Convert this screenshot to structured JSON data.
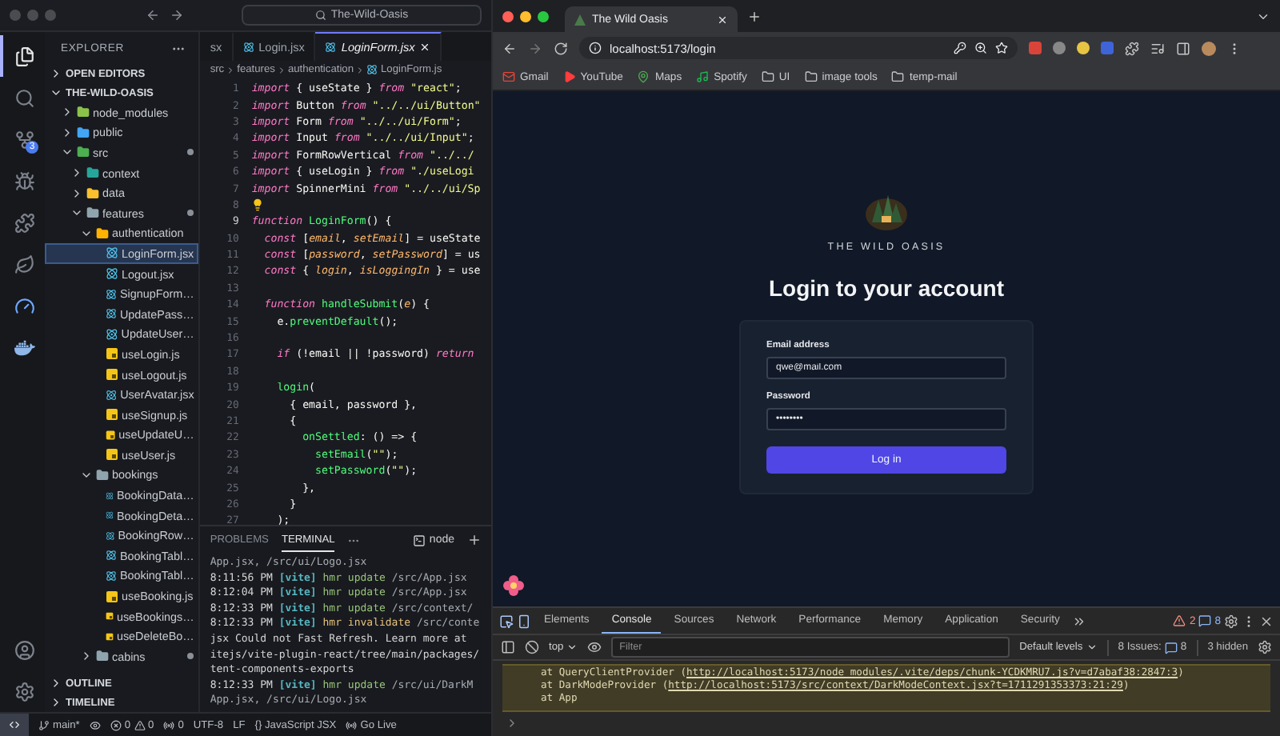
{
  "vscode": {
    "search": "The-Wild-Oasis",
    "activity_bar": [
      {
        "selected": true
      },
      {
        "selected": false
      },
      {
        "selected": false,
        "badge": "3"
      },
      {
        "selected": false
      },
      {
        "selected": false
      },
      {
        "selected": false
      },
      {
        "selected": false
      },
      {
        "selected": false
      }
    ],
    "explorer": {
      "title": "EXPLORER",
      "open_editors": {
        "label": "OPEN EDITORS",
        "expanded": false
      },
      "project": {
        "label": "THE-WILD-OASIS",
        "expanded": true
      },
      "tree": [
        {
          "name": "node_modules",
          "kind": "folder",
          "color": "#8bc34a",
          "expanded": false,
          "modified": false,
          "selected": false
        },
        {
          "name": "public",
          "kind": "folder",
          "color": "#42a5f5",
          "expanded": false,
          "modified": false,
          "selected": false
        },
        {
          "name": "src",
          "kind": "folder",
          "color": "#4caf50",
          "expanded": true,
          "modified": true,
          "selected": false,
          "children": [
            {
              "name": "context",
              "kind": "folder",
              "color": "#26a69a",
              "expanded": false,
              "modified": false,
              "selected": false
            },
            {
              "name": "data",
              "kind": "folder",
              "color": "#fbc02d",
              "expanded": false,
              "modified": false,
              "selected": false
            },
            {
              "name": "features",
              "kind": "folder",
              "color": "#90a4ae",
              "expanded": true,
              "modified": true,
              "selected": false,
              "children": [
                {
                  "name": "authentication",
                  "kind": "folder",
                  "color": "#ffb300",
                  "expanded": true,
                  "modified": false,
                  "selected": false,
                  "children": [
                    {
                      "name": "LoginForm.jsx",
                      "kind": "react",
                      "selected": true
                    },
                    {
                      "name": "Logout.jsx",
                      "kind": "react",
                      "selected": false
                    },
                    {
                      "name": "SignupForm…",
                      "kind": "react",
                      "selected": false
                    },
                    {
                      "name": "UpdatePass…",
                      "kind": "react",
                      "selected": false
                    },
                    {
                      "name": "UpdateUser…",
                      "kind": "react",
                      "selected": false
                    },
                    {
                      "name": "useLogin.js",
                      "kind": "js",
                      "selected": false
                    },
                    {
                      "name": "useLogout.js",
                      "kind": "js",
                      "selected": false
                    },
                    {
                      "name": "UserAvatar.jsx",
                      "kind": "react",
                      "selected": false
                    },
                    {
                      "name": "useSignup.js",
                      "kind": "js",
                      "selected": false
                    },
                    {
                      "name": "useUpdateU…",
                      "kind": "js",
                      "selected": false
                    },
                    {
                      "name": "useUser.js",
                      "kind": "js",
                      "selected": false
                    }
                  ]
                },
                {
                  "name": "bookings",
                  "kind": "folder",
                  "color": "#90a4ae",
                  "expanded": true,
                  "modified": false,
                  "selected": false,
                  "children": [
                    {
                      "name": "BookingData…",
                      "kind": "react",
                      "selected": false
                    },
                    {
                      "name": "BookingDeta…",
                      "kind": "react",
                      "selected": false
                    },
                    {
                      "name": "BookingRow…",
                      "kind": "react",
                      "selected": false
                    },
                    {
                      "name": "BookingTabl…",
                      "kind": "react",
                      "selected": false
                    },
                    {
                      "name": "BookingTabl…",
                      "kind": "react",
                      "selected": false
                    },
                    {
                      "name": "useBooking.js",
                      "kind": "js",
                      "selected": false
                    },
                    {
                      "name": "useBookings…",
                      "kind": "js",
                      "selected": false
                    },
                    {
                      "name": "useDeleteBo…",
                      "kind": "js",
                      "selected": false
                    }
                  ]
                },
                {
                  "name": "cabins",
                  "kind": "folder",
                  "color": "#90a4ae",
                  "expanded": false,
                  "modified": true,
                  "selected": false
                }
              ]
            }
          ]
        }
      ],
      "outline": {
        "label": "OUTLINE",
        "expanded": false
      },
      "timeline": {
        "label": "TIMELINE",
        "expanded": false
      }
    },
    "tabs": [
      {
        "label": "sx",
        "selected": false,
        "icon": false
      },
      {
        "label": "Login.jsx",
        "selected": false,
        "icon": true
      },
      {
        "label": "LoginForm.jsx",
        "selected": true,
        "icon": true
      }
    ],
    "breadcrumb": [
      "src",
      "features",
      "authentication",
      "LoginForm.js"
    ],
    "code": [
      {
        "n": "1",
        "current": false,
        "tokens": [
          {
            "kind": "k",
            "text": "import"
          },
          {
            "kind": "p",
            "text": " { useState } "
          },
          {
            "kind": "k",
            "text": "from"
          },
          {
            "kind": "s",
            "text": " \"react\""
          },
          {
            "kind": "p",
            "text": ";"
          }
        ]
      },
      {
        "n": "2",
        "current": false,
        "tokens": [
          {
            "kind": "k",
            "text": "import"
          },
          {
            "kind": "p",
            "text": " Button "
          },
          {
            "kind": "k",
            "text": "from"
          },
          {
            "kind": "s",
            "text": " \"../../ui/Button\""
          }
        ]
      },
      {
        "n": "3",
        "current": false,
        "tokens": [
          {
            "kind": "k",
            "text": "import"
          },
          {
            "kind": "p",
            "text": " Form "
          },
          {
            "kind": "k",
            "text": "from"
          },
          {
            "kind": "s",
            "text": " \"../../ui/Form\""
          },
          {
            "kind": "p",
            "text": ";"
          }
        ]
      },
      {
        "n": "4",
        "current": false,
        "tokens": [
          {
            "kind": "k",
            "text": "import"
          },
          {
            "kind": "p",
            "text": " Input "
          },
          {
            "kind": "k",
            "text": "from"
          },
          {
            "kind": "s",
            "text": " \"../../ui/Input\""
          },
          {
            "kind": "p",
            "text": ";"
          }
        ]
      },
      {
        "n": "5",
        "current": false,
        "tokens": [
          {
            "kind": "k",
            "text": "import"
          },
          {
            "kind": "p",
            "text": " FormRowVertical "
          },
          {
            "kind": "k",
            "text": "from"
          },
          {
            "kind": "s",
            "text": " \"../../"
          }
        ]
      },
      {
        "n": "6",
        "current": false,
        "tokens": [
          {
            "kind": "k",
            "text": "import"
          },
          {
            "kind": "p",
            "text": " { useLogin } "
          },
          {
            "kind": "k",
            "text": "from"
          },
          {
            "kind": "s",
            "text": " \"./useLogi"
          }
        ]
      },
      {
        "n": "7",
        "current": false,
        "tokens": [
          {
            "kind": "k",
            "text": "import"
          },
          {
            "kind": "p",
            "text": " SpinnerMini "
          },
          {
            "kind": "k",
            "text": "from"
          },
          {
            "kind": "s",
            "text": " \"../../ui/Sp"
          }
        ]
      },
      {
        "n": "8",
        "current": false,
        "hint": true
      },
      {
        "n": "9",
        "current": true,
        "tokens": [
          {
            "kind": "k",
            "text": "function"
          },
          {
            "kind": "f",
            "text": " LoginForm"
          },
          {
            "kind": "p",
            "text": "() {"
          }
        ]
      },
      {
        "n": "10",
        "current": false,
        "tokens": [
          {
            "kind": "k",
            "text": "  const"
          },
          {
            "kind": "p",
            "text": " ["
          },
          {
            "kind": "v",
            "text": "email"
          },
          {
            "kind": "p",
            "text": ", "
          },
          {
            "kind": "v",
            "text": "setEmail"
          },
          {
            "kind": "p",
            "text": "] = useState"
          }
        ]
      },
      {
        "n": "11",
        "current": false,
        "tokens": [
          {
            "kind": "k",
            "text": "  const"
          },
          {
            "kind": "p",
            "text": " ["
          },
          {
            "kind": "v",
            "text": "password"
          },
          {
            "kind": "p",
            "text": ", "
          },
          {
            "kind": "v",
            "text": "setPassword"
          },
          {
            "kind": "p",
            "text": "] = us"
          }
        ]
      },
      {
        "n": "12",
        "current": false,
        "tokens": [
          {
            "kind": "k",
            "text": "  const"
          },
          {
            "kind": "p",
            "text": " { "
          },
          {
            "kind": "v",
            "text": "login"
          },
          {
            "kind": "p",
            "text": ", "
          },
          {
            "kind": "v",
            "text": "isLoggingIn"
          },
          {
            "kind": "p",
            "text": " } = use"
          }
        ]
      },
      {
        "n": "13",
        "current": false
      },
      {
        "n": "14",
        "current": false,
        "tokens": [
          {
            "kind": "k",
            "text": "  function"
          },
          {
            "kind": "f",
            "text": " handleSubmit"
          },
          {
            "kind": "p",
            "text": "("
          },
          {
            "kind": "v",
            "text": "e"
          },
          {
            "kind": "p",
            "text": ") {"
          }
        ]
      },
      {
        "n": "15",
        "current": false,
        "tokens": [
          {
            "kind": "p",
            "text": "    e."
          },
          {
            "kind": "f",
            "text": "preventDefault"
          },
          {
            "kind": "p",
            "text": "();"
          }
        ]
      },
      {
        "n": "16",
        "current": false
      },
      {
        "n": "17",
        "current": false,
        "tokens": [
          {
            "kind": "k",
            "text": "    if"
          },
          {
            "kind": "p",
            "text": " (!email || !password) "
          },
          {
            "kind": "k",
            "text": "return"
          }
        ]
      },
      {
        "n": "18",
        "current": false
      },
      {
        "n": "19",
        "current": false,
        "tokens": [
          {
            "kind": "f",
            "text": "    login"
          },
          {
            "kind": "p",
            "text": "("
          }
        ]
      },
      {
        "n": "20",
        "current": false,
        "tokens": [
          {
            "kind": "p",
            "text": "      { email, password },"
          }
        ]
      },
      {
        "n": "21",
        "current": false,
        "tokens": [
          {
            "kind": "p",
            "text": "      {"
          }
        ]
      },
      {
        "n": "22",
        "current": false,
        "tokens": [
          {
            "kind": "f",
            "text": "        onSettled"
          },
          {
            "kind": "p",
            "text": ": () => {"
          }
        ]
      },
      {
        "n": "23",
        "current": false,
        "tokens": [
          {
            "kind": "f",
            "text": "          setEmail"
          },
          {
            "kind": "p",
            "text": "("
          },
          {
            "kind": "s",
            "text": "\"\""
          },
          {
            "kind": "p",
            "text": ");"
          }
        ]
      },
      {
        "n": "24",
        "current": false,
        "tokens": [
          {
            "kind": "f",
            "text": "          setPassword"
          },
          {
            "kind": "p",
            "text": "("
          },
          {
            "kind": "s",
            "text": "\"\""
          },
          {
            "kind": "p",
            "text": ");"
          }
        ]
      },
      {
        "n": "25",
        "current": false,
        "tokens": [
          {
            "kind": "p",
            "text": "        },"
          }
        ]
      },
      {
        "n": "26",
        "current": false,
        "tokens": [
          {
            "kind": "p",
            "text": "      }"
          }
        ]
      },
      {
        "n": "27",
        "current": false,
        "tokens": [
          {
            "kind": "p",
            "text": "    );"
          }
        ]
      }
    ],
    "panel": {
      "tabs": [
        {
          "label": "PROBLEMS",
          "selected": false
        },
        {
          "label": "TERMINAL",
          "selected": true
        }
      ],
      "shell": "node",
      "terminal": [
        [
          {
            "kind": "d",
            "text": "App.jsx, /src/ui/Logo.jsx"
          }
        ],
        [
          {
            "kind": "t",
            "text": "8:11:56 PM "
          },
          {
            "kind": "v",
            "text": "[vite]"
          },
          {
            "kind": "g",
            "text": " hmr update "
          },
          {
            "kind": "d",
            "text": "/src/App.jsx"
          }
        ],
        [
          {
            "kind": "t",
            "text": "8:12:04 PM "
          },
          {
            "kind": "v",
            "text": "[vite]"
          },
          {
            "kind": "g",
            "text": " hmr update "
          },
          {
            "kind": "d",
            "text": "/src/App.jsx"
          }
        ],
        [
          {
            "kind": "t",
            "text": "8:12:33 PM "
          },
          {
            "kind": "v",
            "text": "[vite]"
          },
          {
            "kind": "g",
            "text": " hmr update "
          },
          {
            "kind": "d",
            "text": "/src/context/"
          }
        ],
        [
          {
            "kind": "t",
            "text": "8:12:33 PM "
          },
          {
            "kind": "v",
            "text": "[vite]"
          },
          {
            "kind": "y",
            "text": " hmr invalidate "
          },
          {
            "kind": "d",
            "text": "/src/conte"
          }
        ],
        [
          {
            "kind": "t",
            "text": "jsx Could not Fast Refresh. Learn more at"
          }
        ],
        [
          {
            "kind": "t",
            "text": "itejs/vite-plugin-react/tree/main/packages/"
          }
        ],
        [
          {
            "kind": "t",
            "text": "tent-components-exports"
          }
        ],
        [
          {
            "kind": "t",
            "text": "8:12:33 PM "
          },
          {
            "kind": "v",
            "text": "[vite]"
          },
          {
            "kind": "g",
            "text": " hmr update "
          },
          {
            "kind": "d",
            "text": "/src/ui/DarkM"
          }
        ],
        [
          {
            "kind": "d",
            "text": "App.jsx, /src/ui/Logo.jsx"
          }
        ]
      ]
    },
    "status": {
      "branch": "main*",
      "errors": "0",
      "warnings": "0",
      "signal_count": "0",
      "encoding": "UTF-8",
      "eol": "LF",
      "language": "{} JavaScript JSX",
      "live": "Go Live"
    }
  },
  "browser": {
    "tab": {
      "title": "The Wild Oasis",
      "selected": true
    },
    "url": "localhost:5173/login",
    "bookmarks": [
      {
        "label": "Gmail",
        "kind": "mail"
      },
      {
        "label": "YouTube",
        "kind": "video"
      },
      {
        "label": "Maps",
        "kind": "pin"
      },
      {
        "label": "Spotify",
        "kind": "music"
      },
      {
        "label": "UI",
        "kind": "folder"
      },
      {
        "label": "image tools",
        "kind": "folder"
      },
      {
        "label": "temp-mail",
        "kind": "folder"
      }
    ],
    "page": {
      "brand": "THE WILD OASIS",
      "heading": "Login to your account",
      "fields": [
        {
          "label": "Email address",
          "value": "qwe@mail.com"
        },
        {
          "label": "Password",
          "value": "••••••••"
        }
      ],
      "submit": "Log in"
    },
    "devtools": {
      "tabs": [
        {
          "label": "Elements",
          "selected": false
        },
        {
          "label": "Console",
          "selected": true
        },
        {
          "label": "Sources",
          "selected": false
        },
        {
          "label": "Network",
          "selected": false
        },
        {
          "label": "Performance",
          "selected": false
        },
        {
          "label": "Memory",
          "selected": false
        },
        {
          "label": "Application",
          "selected": false
        },
        {
          "label": "Security",
          "selected": false
        }
      ],
      "warnings": "2",
      "messages": "8",
      "context": "top",
      "filter_placeholder": "Filter",
      "levels": "Default levels",
      "issues_label": "8 Issues:",
      "issues_count": "8",
      "hidden": "3 hidden",
      "stack": [
        {
          "text": "at QueryClientProvider (",
          "link": "http://localhost:5173/node_modules/.vite/deps/chunk-YCDKMRU7.js?v=d7abaf38:2847:3",
          "tail": ")"
        },
        {
          "text": "at DarkModeProvider (",
          "link": "http://localhost:5173/src/context/DarkModeContext.jsx?t=1711291353373:21:29",
          "tail": ")"
        },
        {
          "text": "at App"
        }
      ]
    }
  }
}
